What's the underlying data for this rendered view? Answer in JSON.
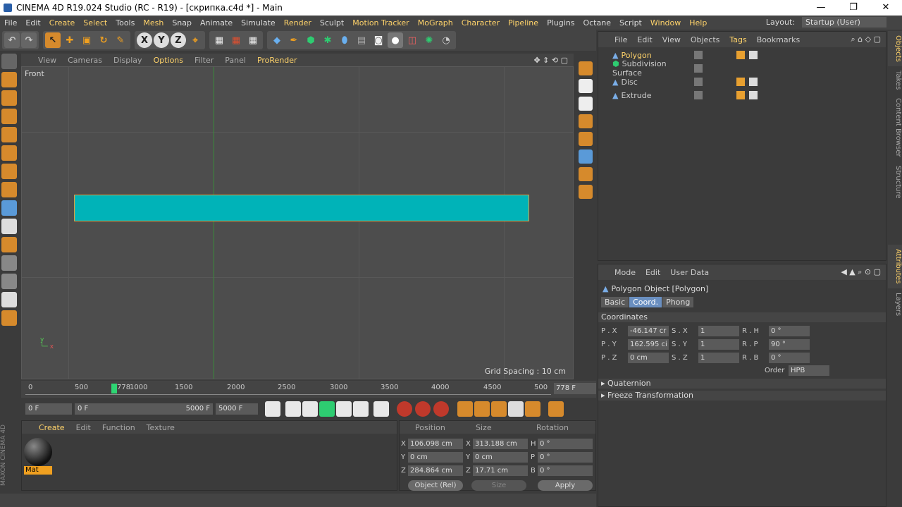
{
  "window": {
    "title": "CINEMA 4D R19.024 Studio (RC - R19) - [скрипка.c4d *] - Main",
    "minimize": "—",
    "maximize": "❐",
    "close": "✕"
  },
  "menu": {
    "items": [
      "File",
      "Edit",
      "Create",
      "Select",
      "Tools",
      "Mesh",
      "Snap",
      "Animate",
      "Simulate",
      "Render",
      "Sculpt",
      "Motion Tracker",
      "MoGraph",
      "Character",
      "Pipeline",
      "Plugins",
      "Octane",
      "Script",
      "Window",
      "Help"
    ],
    "layout_label": "Layout:",
    "layout_value": "Startup (User)"
  },
  "toolbar": {
    "axis_x": "X",
    "axis_y": "Y",
    "axis_z": "Z"
  },
  "viewport": {
    "menu": [
      "View",
      "Cameras",
      "Display",
      "Options",
      "Filter",
      "Panel",
      "ProRender"
    ],
    "view_name": "Front",
    "grid_spacing": "Grid Spacing : 10 cm",
    "shape_color": "#00b3b8"
  },
  "timeline": {
    "ticks": [
      "0",
      "500",
      "778",
      "1000",
      "1500",
      "2000",
      "2500",
      "3000",
      "3500",
      "4000",
      "4500",
      "500"
    ],
    "current_frame": "778 F"
  },
  "transport": {
    "start": "0 F",
    "range_start": "0 F",
    "range_end": "5000 F",
    "end": "5000 F"
  },
  "material_panel": {
    "menu": [
      "Create",
      "Edit",
      "Function",
      "Texture"
    ],
    "material_name": "Mat",
    "maxon_label": "MAXON CINEMA 4D"
  },
  "coord_panel": {
    "headers": [
      "Position",
      "Size",
      "Rotation"
    ],
    "rows": [
      {
        "pos_label": "X",
        "pos": "106.098 cm",
        "size_label": "X",
        "size": "313.188 cm",
        "rot_label": "H",
        "rot": "0 °"
      },
      {
        "pos_label": "Y",
        "pos": "0 cm",
        "size_label": "Y",
        "size": "0 cm",
        "rot_label": "P",
        "rot": "0 °"
      },
      {
        "pos_label": "Z",
        "pos": "284.864 cm",
        "size_label": "Z",
        "size": "17.71 cm",
        "rot_label": "B",
        "rot": "0 °"
      }
    ],
    "mode": "Object (Rel)",
    "size_mode": "Size",
    "apply": "Apply"
  },
  "objects_panel": {
    "menu": [
      "File",
      "Edit",
      "View",
      "Objects",
      "Tags",
      "Bookmarks"
    ],
    "objects": [
      {
        "name": "Polygon",
        "selected": true
      },
      {
        "name": "Subdivision Surface",
        "selected": false
      },
      {
        "name": "Disc",
        "selected": false
      },
      {
        "name": "Extrude",
        "selected": false
      }
    ]
  },
  "attributes_panel": {
    "menu": [
      "Mode",
      "Edit",
      "User Data"
    ],
    "object_title": "Polygon Object [Polygon]",
    "tabs": [
      "Basic",
      "Coord.",
      "Phong"
    ],
    "active_tab": "Coord.",
    "section": "Coordinates",
    "rows": [
      {
        "a_label": "P . X",
        "a": "-46.147 cr",
        "b_label": "S . X",
        "b": "1",
        "c_label": "R . H",
        "c": "0 °"
      },
      {
        "a_label": "P . Y",
        "a": "162.595 ci",
        "b_label": "S . Y",
        "b": "1",
        "c_label": "R . P",
        "c": "90 °"
      },
      {
        "a_label": "P . Z",
        "a": "0 cm",
        "b_label": "S . Z",
        "b": "1",
        "c_label": "R . B",
        "c": "0 °"
      }
    ],
    "order_label": "Order",
    "order_value": "HPB",
    "quaternion": "Quaternion",
    "freeze": "Freeze Transformation"
  },
  "side_tabs": [
    "Objects",
    "Takes",
    "Content Browser",
    "Structure",
    "Attributes",
    "Layers"
  ]
}
